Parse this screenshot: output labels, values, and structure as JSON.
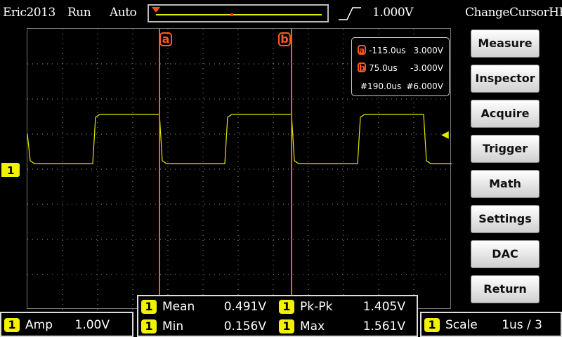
{
  "topbar": {
    "user": "Eric2013",
    "run_state": "Run",
    "trigger_mode": "Auto",
    "trigger_level": "1.000V",
    "app_title": "ChangeCursorHB"
  },
  "cursors": {
    "a_label": "a",
    "b_label": "b",
    "readout": {
      "a_time": "-115.0us",
      "a_volt": "3.000V",
      "b_time": "75.0us",
      "b_volt": "-3.000V",
      "delta_time": "#190.0us",
      "delta_volt": "#6.000V"
    }
  },
  "channel": {
    "number": "1",
    "color": "#e8e800"
  },
  "menu": [
    {
      "label": "Measure"
    },
    {
      "label": "Inspector"
    },
    {
      "label": "Acquire"
    },
    {
      "label": "Trigger"
    },
    {
      "label": "Math"
    },
    {
      "label": "Settings"
    },
    {
      "label": "DAC"
    },
    {
      "label": "Return"
    }
  ],
  "measurements": {
    "mean_label": "Mean",
    "mean_value": "0.491V",
    "pkpk_label": "Pk-Pk",
    "pkpk_value": "1.405V",
    "min_label": "Min",
    "min_value": "0.156V",
    "max_label": "Max",
    "max_value": "1.561V"
  },
  "amp": {
    "label": "Amp",
    "value": "1.00V"
  },
  "scale": {
    "label": "Scale",
    "value": "1us / 3"
  }
}
